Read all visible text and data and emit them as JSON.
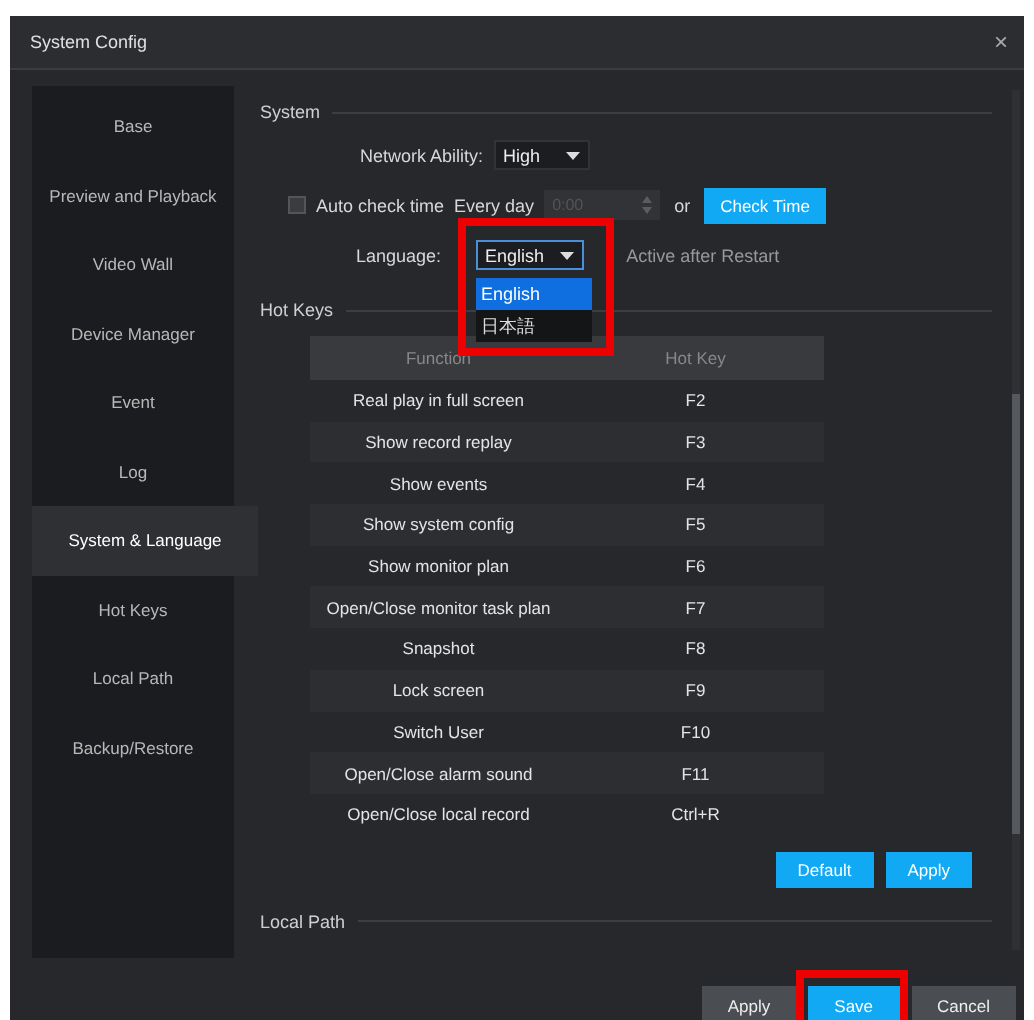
{
  "window": {
    "title": "System Config",
    "close": "×"
  },
  "sidebar": {
    "items": [
      {
        "label": "Base",
        "selected": false
      },
      {
        "label": "Preview and Playback",
        "selected": false
      },
      {
        "label": "Video Wall",
        "selected": false
      },
      {
        "label": "Device Manager",
        "selected": false
      },
      {
        "label": "Event",
        "selected": false
      },
      {
        "label": "Log",
        "selected": false
      },
      {
        "label": "System & Language",
        "selected": true
      },
      {
        "label": "Hot Keys",
        "selected": false
      },
      {
        "label": "Local Path",
        "selected": false
      },
      {
        "label": "Backup/Restore",
        "selected": false
      }
    ]
  },
  "system": {
    "heading": "System",
    "network_ability": {
      "label": "Network Ability:",
      "value": "High"
    },
    "auto_check": {
      "checked": false,
      "label": "Auto check time",
      "frequency": "Every day",
      "time_value": "0:00",
      "disabled": true,
      "or": "or",
      "button": "Check Time"
    },
    "language": {
      "label": "Language:",
      "value": "English",
      "note": "Active after Restart",
      "highlighted": true,
      "dropdown": {
        "expanded": true,
        "options": [
          {
            "label": "English",
            "selected": true
          },
          {
            "label": "日本語",
            "selected": false
          }
        ]
      }
    }
  },
  "hot_keys": {
    "heading": "Hot Keys",
    "columns": [
      "Function",
      "Hot Key"
    ],
    "rows": [
      [
        "Real play in full screen",
        "F2"
      ],
      [
        "Show record replay",
        "F3"
      ],
      [
        "Show events",
        "F4"
      ],
      [
        "Show system config",
        "F5"
      ],
      [
        "Show monitor plan",
        "F6"
      ],
      [
        "Open/Close monitor task plan",
        "F7"
      ],
      [
        "Snapshot",
        "F8"
      ],
      [
        "Lock screen",
        "F9"
      ],
      [
        "Switch User",
        "F10"
      ],
      [
        "Open/Close alarm sound",
        "F11"
      ],
      [
        "Open/Close local record",
        "Ctrl+R"
      ]
    ],
    "buttons": [
      "Default",
      "Apply"
    ]
  },
  "local_path": {
    "heading": "Local Path"
  },
  "footer": {
    "buttons": [
      {
        "label": "Apply",
        "kind": "secondary",
        "highlighted": false
      },
      {
        "label": "Save",
        "kind": "primary",
        "highlighted": true
      },
      {
        "label": "Cancel",
        "kind": "secondary",
        "highlighted": false
      }
    ]
  }
}
